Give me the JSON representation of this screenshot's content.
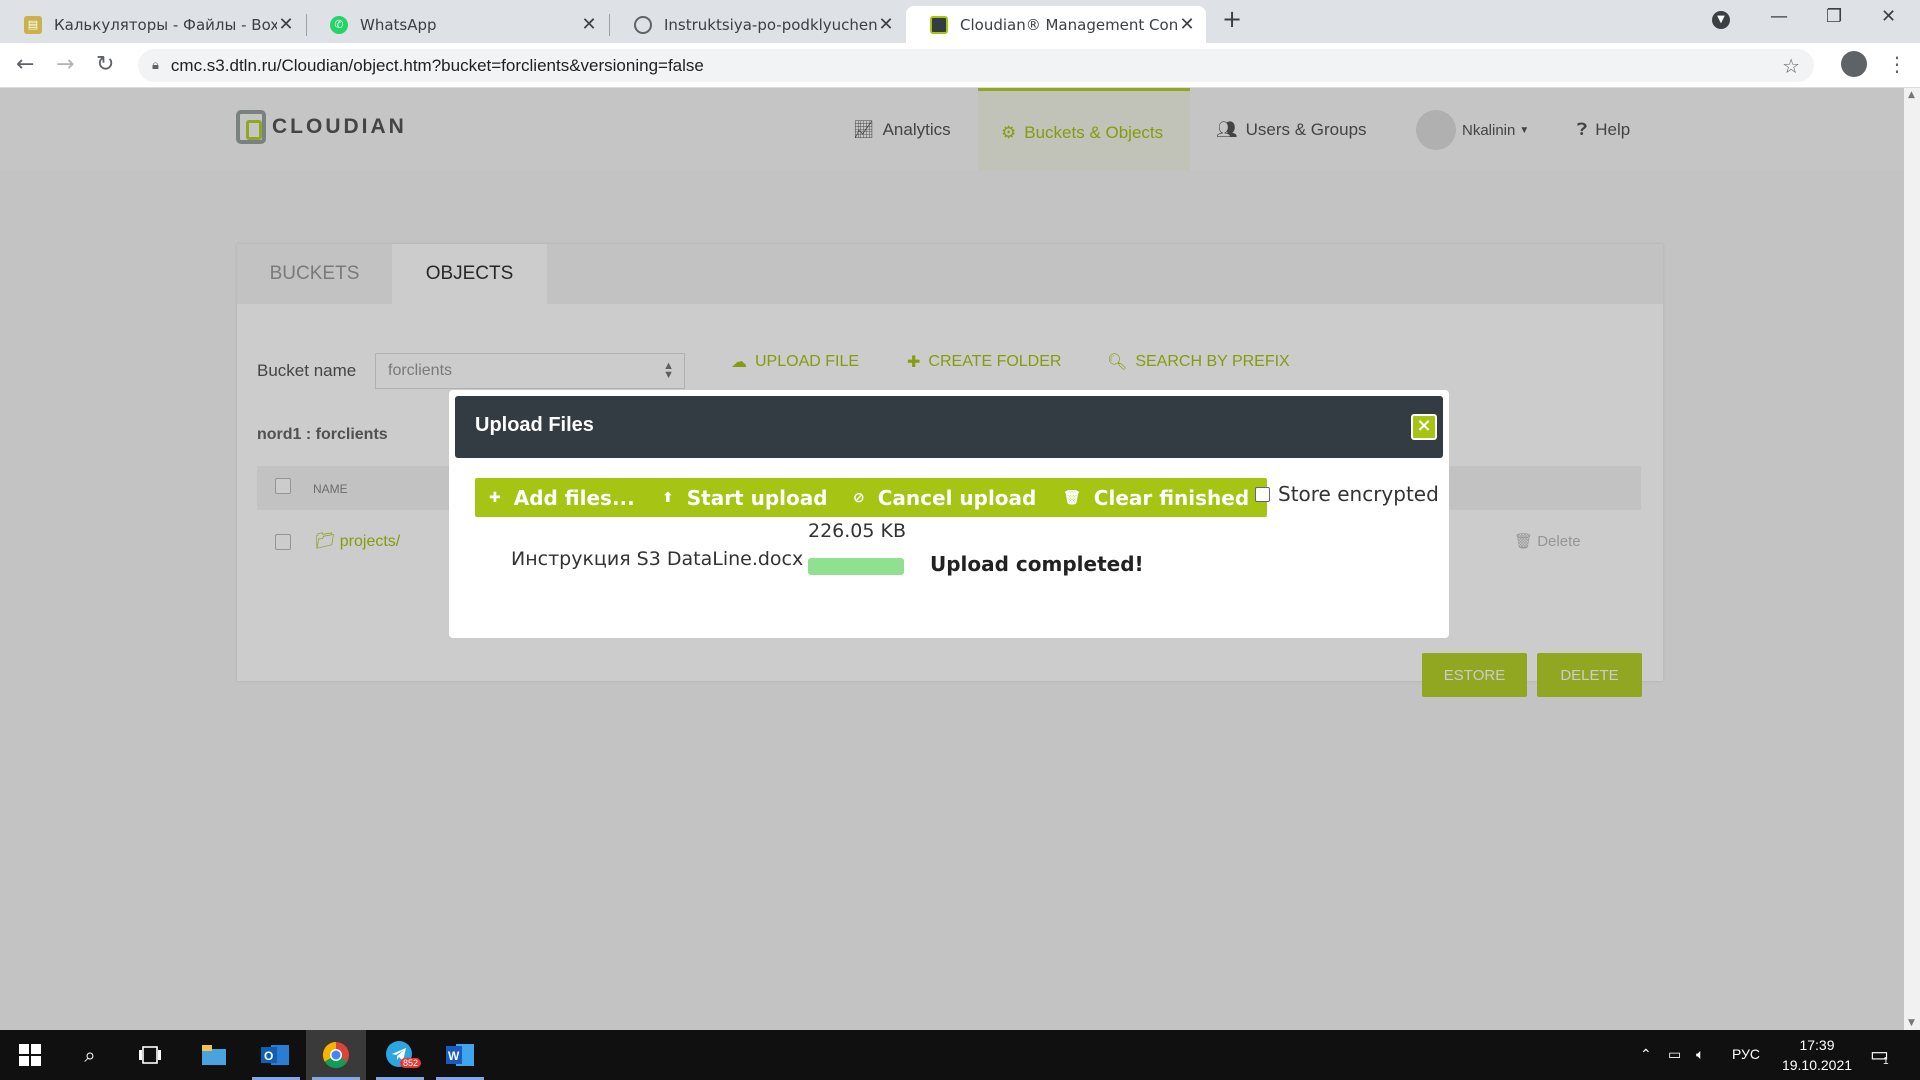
{
  "browser": {
    "tabs": [
      {
        "title": "Калькуляторы - Файлы - Box",
        "close": "✕"
      },
      {
        "title": "WhatsApp",
        "close": "✕"
      },
      {
        "title": "Instruktsiya-po-podklyucheniyu-l",
        "close": "✕"
      },
      {
        "title": "Cloudian® Management Console",
        "close": "✕",
        "active": true
      }
    ],
    "new_tab": "+",
    "url": "cmc.s3.dtln.ru/Cloudian/object.htm?bucket=forclients&versioning=false"
  },
  "app": {
    "logo": "CLOUDIAN",
    "nav": {
      "analytics": "Analytics",
      "buckets": "Buckets & Objects",
      "users": "Users & Groups",
      "user": "Nkalinin",
      "help": "Help"
    },
    "tabs": {
      "buckets": "BUCKETS",
      "objects": "OBJECTS"
    },
    "bucket_label": "Bucket name",
    "bucket_value": "forclients",
    "actions": {
      "upload": "UPLOAD FILE",
      "create_folder": "CREATE FOLDER",
      "search": "SEARCH BY PREFIX"
    },
    "path": "nord1 : forclients",
    "table": {
      "col_name": "NAME",
      "row_name": "projects/",
      "row_delete": "Delete"
    },
    "restore_btn": "ESTORE",
    "delete_btn": "DELETE"
  },
  "modal": {
    "title": "Upload Files",
    "close": "×",
    "buttons": {
      "add": "Add files...",
      "start": "Start upload",
      "cancel": "Cancel upload",
      "clear": "Clear finished"
    },
    "encrypt_label": "Store encrypted",
    "file": {
      "name": "Инструкция S3 DataLine.docx",
      "size": "226.05 KB",
      "progress": 1.0,
      "status": "Upload completed!"
    }
  },
  "taskbar": {
    "telegram_badge": "852",
    "lang": "РУС",
    "time": "17:39",
    "date": "19.10.2021",
    "notif_count": "1"
  },
  "colors": {
    "accent": "#a6c414",
    "modal_header": "#333c43",
    "progress_fill": "#90e090"
  }
}
